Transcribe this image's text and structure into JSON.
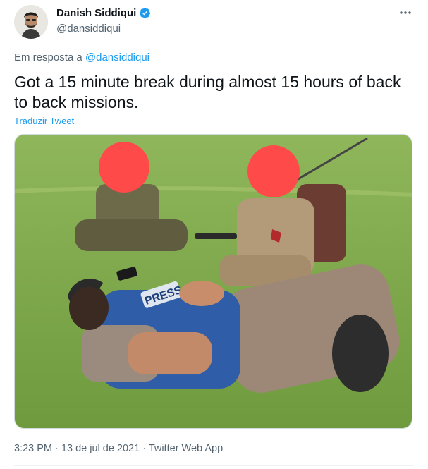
{
  "author": {
    "display_name": "Danish Siddiqui",
    "handle": "@dansiddiqui",
    "verified": true
  },
  "reply_context": {
    "prefix": "Em resposta a",
    "mention": "@dansiddiqui"
  },
  "tweet": {
    "text": "Got a 15 minute break during almost 15 hours of back to back missions.",
    "translate_label": "Traduzir Tweet",
    "time": "3:23 PM",
    "date": "13 de jul de 2021",
    "source": "Twitter Web App",
    "separator": "·"
  },
  "media": {
    "vest_label": "PRESS"
  },
  "colors": {
    "accent": "#1d9bf0",
    "secondary_text": "#536471",
    "primary_text": "#0f1419"
  },
  "icons": {
    "verified": "verified-badge-icon",
    "more": "more-options-icon"
  }
}
